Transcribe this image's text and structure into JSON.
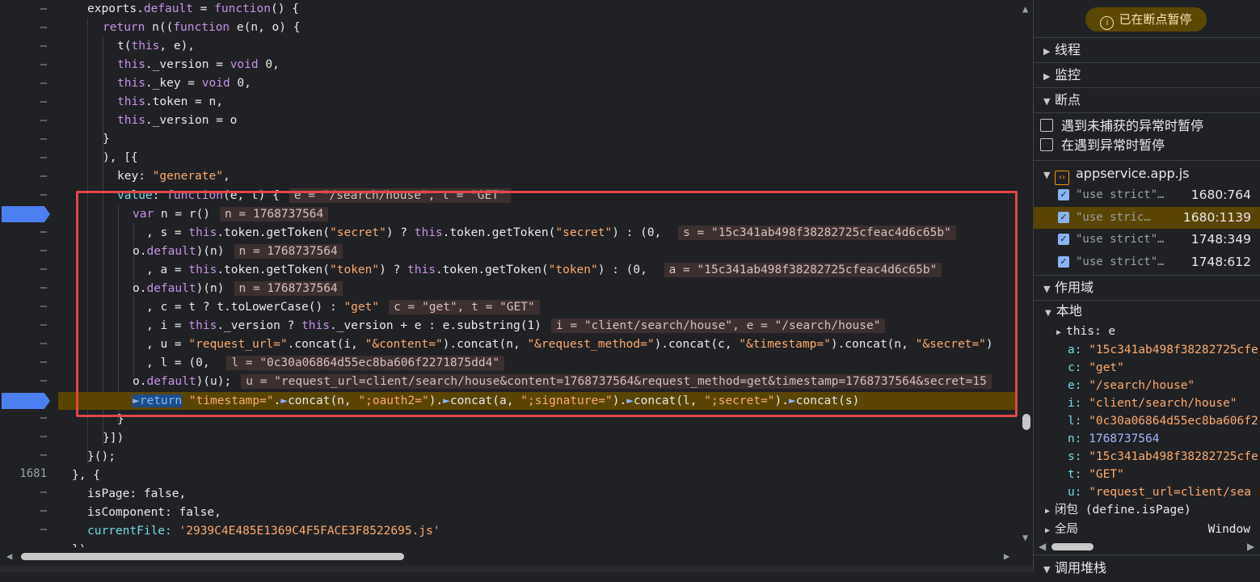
{
  "editor": {
    "gutter": [
      "–",
      "–",
      "–",
      "–",
      "–",
      "–",
      "–",
      "–",
      "–",
      "–",
      "–",
      "–",
      "–",
      "–",
      "–",
      "–",
      "–",
      "–",
      "–",
      "–",
      "–",
      "–",
      "–",
      "–",
      "–",
      "1681",
      "–",
      "–",
      "–"
    ],
    "lines": [
      {
        "indent": 1,
        "html": "<span class='prop'>exports</span>.<span class='kw'>default</span> = <span class='kw'>function</span>() {"
      },
      {
        "indent": 2,
        "html": "<span class='kw'>return</span> n((<span class='kw'>function</span> e(n, o) {"
      },
      {
        "indent": 3,
        "html": "t(<span class='kw'>this</span>, e),"
      },
      {
        "indent": 3,
        "html": "<span class='kw'>this</span>._version = <span class='kw'>void</span> 0,"
      },
      {
        "indent": 3,
        "html": "<span class='kw'>this</span>._key = <span class='kw'>void</span> 0,"
      },
      {
        "indent": 3,
        "html": "<span class='kw'>this</span>.token = n,"
      },
      {
        "indent": 3,
        "html": "<span class='kw'>this</span>._version = o"
      },
      {
        "indent": 2,
        "html": "}"
      },
      {
        "indent": 2,
        "html": "), [{"
      },
      {
        "indent": 3,
        "html": "<span class='prop'>key</span>: <span class='str'>\"generate\"</span>,"
      }
    ],
    "current_line_numbers": [
      "1681"
    ],
    "chips": {
      "value_line": "e = \"/search/house\", t = \"GET\"",
      "n1": "n = 1768737564",
      "s": "s = \"15c341ab498f38282725cfeac4d6c65b\"",
      "n2": "n = 1768737564",
      "a": "a = \"15c341ab498f38282725cfeac4d6c65b\"",
      "n3": "n = 1768737564",
      "c": "c = \"get\", t = \"GET\"",
      "i": "i = \"client/search/house\", e = \"/search/house\"",
      "l": "l = \"0c30a06864d55ec8ba606f2271875dd4\"",
      "u": "u = \"request_url=client/search/house&content=1768737564&request_method=get&timestamp=1768737564&secret=15"
    },
    "tail_lines": {
      "is_page": "isPage: false,",
      "is_component": "isComponent: false,",
      "current_file_key": "currentFile:",
      "current_file_val": "'2939C4E485E1369C4F5FACE3F8522695.js'"
    }
  },
  "sidebar": {
    "paused_label": "已在断点暂停",
    "paused_icon": "info-icon",
    "sections": {
      "threads": "线程",
      "watch": "监控",
      "breakpoints": "断点",
      "scope": "作用域",
      "call_stack": "调用堆栈"
    },
    "checkboxes": [
      "遇到未捕获的异常时暂停",
      "在遇到异常时暂停"
    ],
    "file": "appservice.app.js",
    "breakpoints": [
      {
        "code": "\"use strict\"…",
        "loc": "1680:764",
        "active": false
      },
      {
        "code": "\"use stric…",
        "loc": "1680:1139",
        "active": true
      },
      {
        "code": "\"use strict\"…",
        "loc": "1748:349",
        "active": false
      },
      {
        "code": "\"use strict\"…",
        "loc": "1748:612",
        "active": false
      }
    ],
    "scope": {
      "local_label": "本地",
      "this_row": "this: e",
      "vars": [
        {
          "k": "a",
          "v": "\"15c341ab498f38282725cfe",
          "t": "str"
        },
        {
          "k": "c",
          "v": "\"get\"",
          "t": "str"
        },
        {
          "k": "e",
          "v": "\"/search/house\"",
          "t": "str"
        },
        {
          "k": "i",
          "v": "\"client/search/house\"",
          "t": "str"
        },
        {
          "k": "l",
          "v": "\"0c30a06864d55ec8ba606f2",
          "t": "str"
        },
        {
          "k": "n",
          "v": "1768737564",
          "t": "num"
        },
        {
          "k": "s",
          "v": "\"15c341ab498f38282725cfe",
          "t": "str"
        },
        {
          "k": "t",
          "v": "\"GET\"",
          "t": "str"
        },
        {
          "k": "u",
          "v": "\"request_url=client/sea",
          "t": "str"
        }
      ],
      "closure": "闭包 (define.isPage)",
      "global": "全局",
      "global_val": "Window"
    }
  },
  "colors": {
    "bg": "#202124",
    "paused_line": "#5a4500",
    "breakpoint": "#4c7ff0",
    "highlight_box": "#e0474a"
  }
}
